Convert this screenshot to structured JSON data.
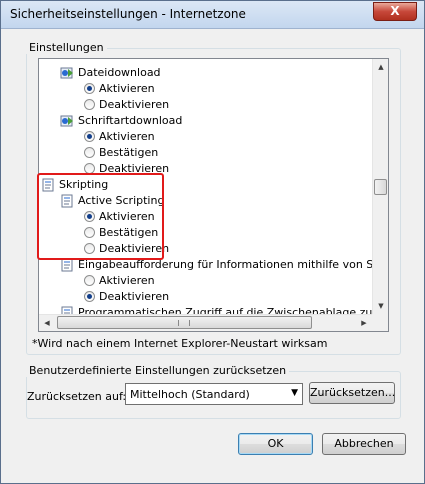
{
  "window": {
    "title": "Sicherheitseinstellungen - Internetzone",
    "close_label": "X"
  },
  "settings_group": {
    "label": "Einstellungen",
    "items": [
      {
        "type": "category",
        "label": "Dateidownload",
        "icon": "settings-category-icon"
      },
      {
        "type": "option",
        "label": "Aktivieren",
        "checked": true
      },
      {
        "type": "option",
        "label": "Deaktivieren",
        "checked": false
      },
      {
        "type": "category",
        "label": "Schriftartdownload",
        "icon": "settings-category-icon"
      },
      {
        "type": "option",
        "label": "Aktivieren",
        "checked": true
      },
      {
        "type": "option",
        "label": "Bestätigen",
        "checked": false
      },
      {
        "type": "option",
        "label": "Deaktivieren",
        "checked": false
      },
      {
        "type": "group",
        "label": "Skripting",
        "icon": "script-document-icon"
      },
      {
        "type": "category",
        "label": "Active Scripting",
        "icon": "script-document-icon"
      },
      {
        "type": "option",
        "label": "Aktivieren",
        "checked": true
      },
      {
        "type": "option",
        "label": "Bestätigen",
        "checked": false
      },
      {
        "type": "option",
        "label": "Deaktivieren",
        "checked": false
      },
      {
        "type": "category",
        "label": "Eingabeaufforderung für Informationen mithilfe von Skriptfer",
        "icon": "script-document-icon"
      },
      {
        "type": "option",
        "label": "Aktivieren",
        "checked": false
      },
      {
        "type": "option",
        "label": "Deaktivieren",
        "checked": true
      },
      {
        "type": "category",
        "label": "Programmatischen Zugriff auf die Zwischenablage zulassen",
        "icon": "script-document-icon"
      }
    ],
    "note": "*Wird nach einem Internet Explorer-Neustart wirksam"
  },
  "reset_group": {
    "label": "Benutzerdefinierte Einstellungen zurücksetzen",
    "reset_to_label": "Zurücksetzen auf:",
    "selected_level": "Mittelhoch (Standard)",
    "reset_button": "Zurücksetzen..."
  },
  "buttons": {
    "ok": "OK",
    "cancel": "Abbrechen"
  },
  "colors": {
    "highlight": "#e11a1a",
    "selected_radio": "#123e8a"
  }
}
